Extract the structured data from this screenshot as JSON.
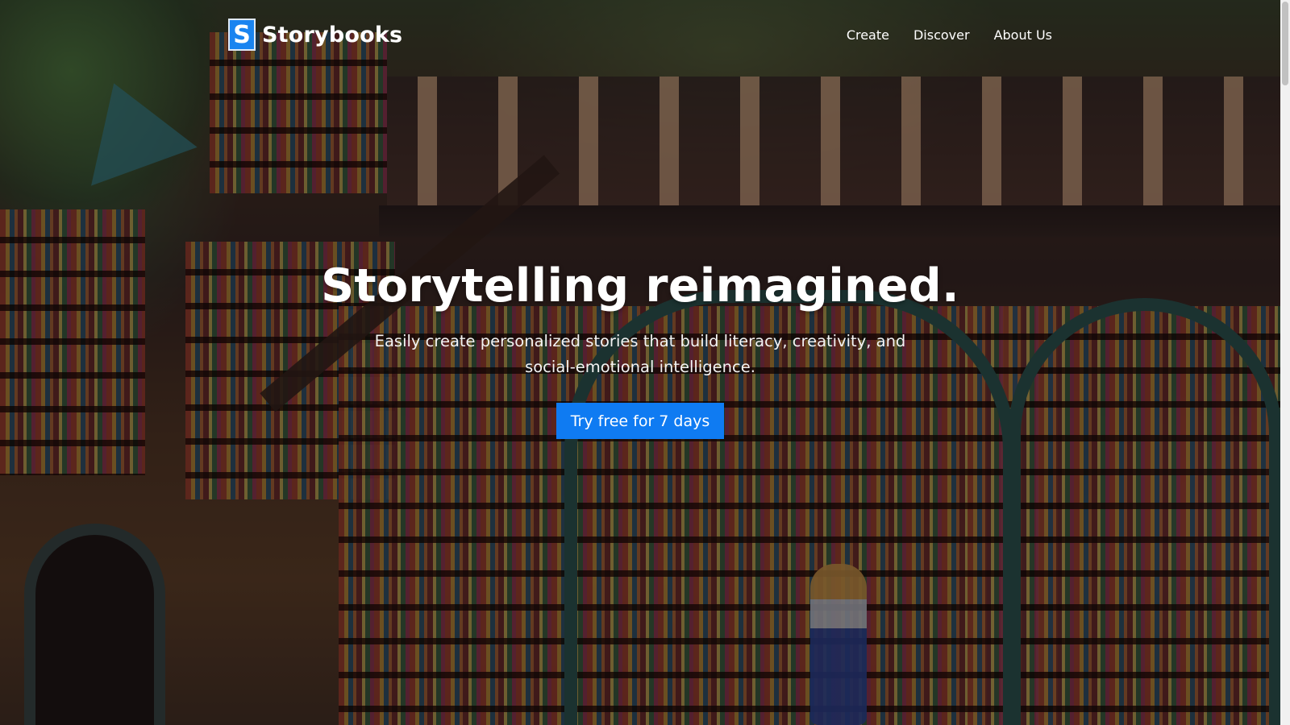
{
  "header": {
    "logo_letter": "S",
    "brand_name": "Storybooks",
    "nav": [
      {
        "label": "Create"
      },
      {
        "label": "Discover"
      },
      {
        "label": "About Us"
      }
    ]
  },
  "hero": {
    "title": "Storytelling reimagined.",
    "subtitle": "Easily create personalized stories that build literacy, creativity, and social-emotional intelligence.",
    "cta_label": "Try free for 7 days"
  },
  "colors": {
    "accent": "#0f7bf2",
    "logo_blue": "#1a84f0",
    "text": "#ffffff"
  },
  "icons": {
    "logo": "storybooks-logo-icon"
  }
}
